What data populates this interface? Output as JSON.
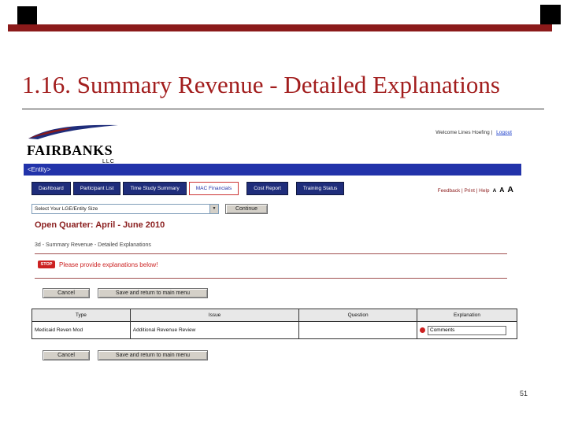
{
  "colors": {
    "maroon": "#8B1A1A",
    "title_red": "#A21E1E",
    "navy": "#1F2D7B",
    "blue": "#2233AA",
    "alert_red": "#CC2222",
    "button_grey": "#D4D0C8",
    "link_blue": "#2244CC"
  },
  "slide": {
    "title": "1.16. Summary Revenue - Detailed Explanations",
    "page_number": "51"
  },
  "app": {
    "logo": {
      "name": "FAIRBANKS",
      "suffix": "LLC"
    },
    "header": {
      "welcome": "Welcome Lines Hoefing |",
      "logout": "Logout"
    },
    "entity_bar": {
      "label": "<Entity>"
    },
    "nav": [
      {
        "label": "Dashboard"
      },
      {
        "label": "Participant List"
      },
      {
        "label": "Time Study Summary"
      },
      {
        "label": "MAC Financials"
      },
      {
        "label": "Cost Report"
      },
      {
        "label": "Training Status"
      }
    ],
    "utility": {
      "links": "Feedback | Print | Help",
      "sizes": [
        "A",
        "A",
        "A"
      ]
    },
    "filter": {
      "select_label": "Select Your LGE/Entity Size",
      "continue_label": "Continue"
    },
    "quarter": "Open Quarter: April - June 2010",
    "section": "3d - Summary Revenue - Detailed Explanations",
    "alert": {
      "badge": "STOP",
      "message": "Please provide explanations below!"
    },
    "actions": {
      "cancel": "Cancel",
      "save": "Save and return to main menu"
    },
    "table": {
      "headers": [
        "Type",
        "Issue",
        "Question",
        "Explanation"
      ],
      "row": {
        "type": "Medicaid Reven Mod",
        "issue": "Additional Revenue Review",
        "question": "",
        "comment_value": "Comments"
      }
    }
  }
}
